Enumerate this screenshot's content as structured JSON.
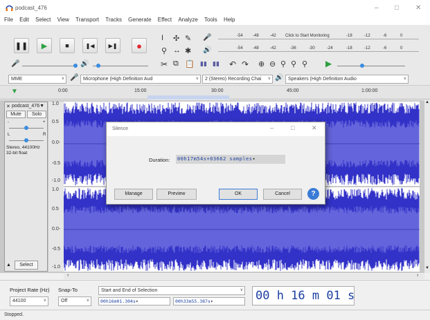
{
  "window": {
    "title": "podcast_476",
    "minimize": "–",
    "maximize": "□",
    "close": "✕"
  },
  "menu": [
    "File",
    "Edit",
    "Select",
    "View",
    "Transport",
    "Tracks",
    "Generate",
    "Effect",
    "Analyze",
    "Tools",
    "Help"
  ],
  "meters": {
    "record_label": "L R",
    "record_scale": [
      "-54",
      "-48",
      "-42",
      "Click to Start Monitoring",
      "-18",
      "-12",
      "-6",
      "0"
    ],
    "play_scale": [
      "-54",
      "-48",
      "-42",
      "-36",
      "-30",
      "-24",
      "-18",
      "-12",
      "-6",
      "0"
    ]
  },
  "devices": {
    "host": "MME",
    "mic": "Microphone (High Definition Aud",
    "channels": "2 (Stereo) Recording Chai",
    "speakers": "Speakers (High Definition Audio"
  },
  "timeline": {
    "ticks": [
      "0:00",
      "15:00",
      "30:00",
      "45:00",
      "1:00:00"
    ]
  },
  "track": {
    "name": "podcast_476▼",
    "mute": "Mute",
    "solo": "Solo",
    "gain_minus": "-",
    "gain_plus": "+",
    "pan_l": "L",
    "pan_r": "R",
    "info": "Stereo, 44100Hz\n32-bit float",
    "select": "Select",
    "scale": [
      "1.0",
      "0.5",
      "0.0-",
      "-0.5",
      "-1.0",
      "1.0",
      "0.5",
      "0.0-",
      "-0.5",
      "-1.0"
    ]
  },
  "dialog": {
    "title": "Silence",
    "duration_label": "Duration:",
    "duration_value": "00h17m54s+03662 samples",
    "manage": "Manage",
    "preview": "Preview",
    "ok": "OK",
    "cancel": "Cancel",
    "help": "?"
  },
  "selection": {
    "rate_label": "Project Rate (Hz)",
    "rate_value": "44100",
    "snap_label": "Snap-To",
    "snap_value": "Off",
    "mode": "Start and End of Selection",
    "start": "00h16m01.304s",
    "end": "00h33m55.387s",
    "big_time": "00 h 16 m 01 s"
  },
  "status": "Stopped.",
  "colors": {
    "wave": "#3232c8",
    "wave_light": "#6464dc",
    "wave_bg": "#ffffff",
    "play_green": "#2ea043",
    "record_red": "#e0262e"
  }
}
